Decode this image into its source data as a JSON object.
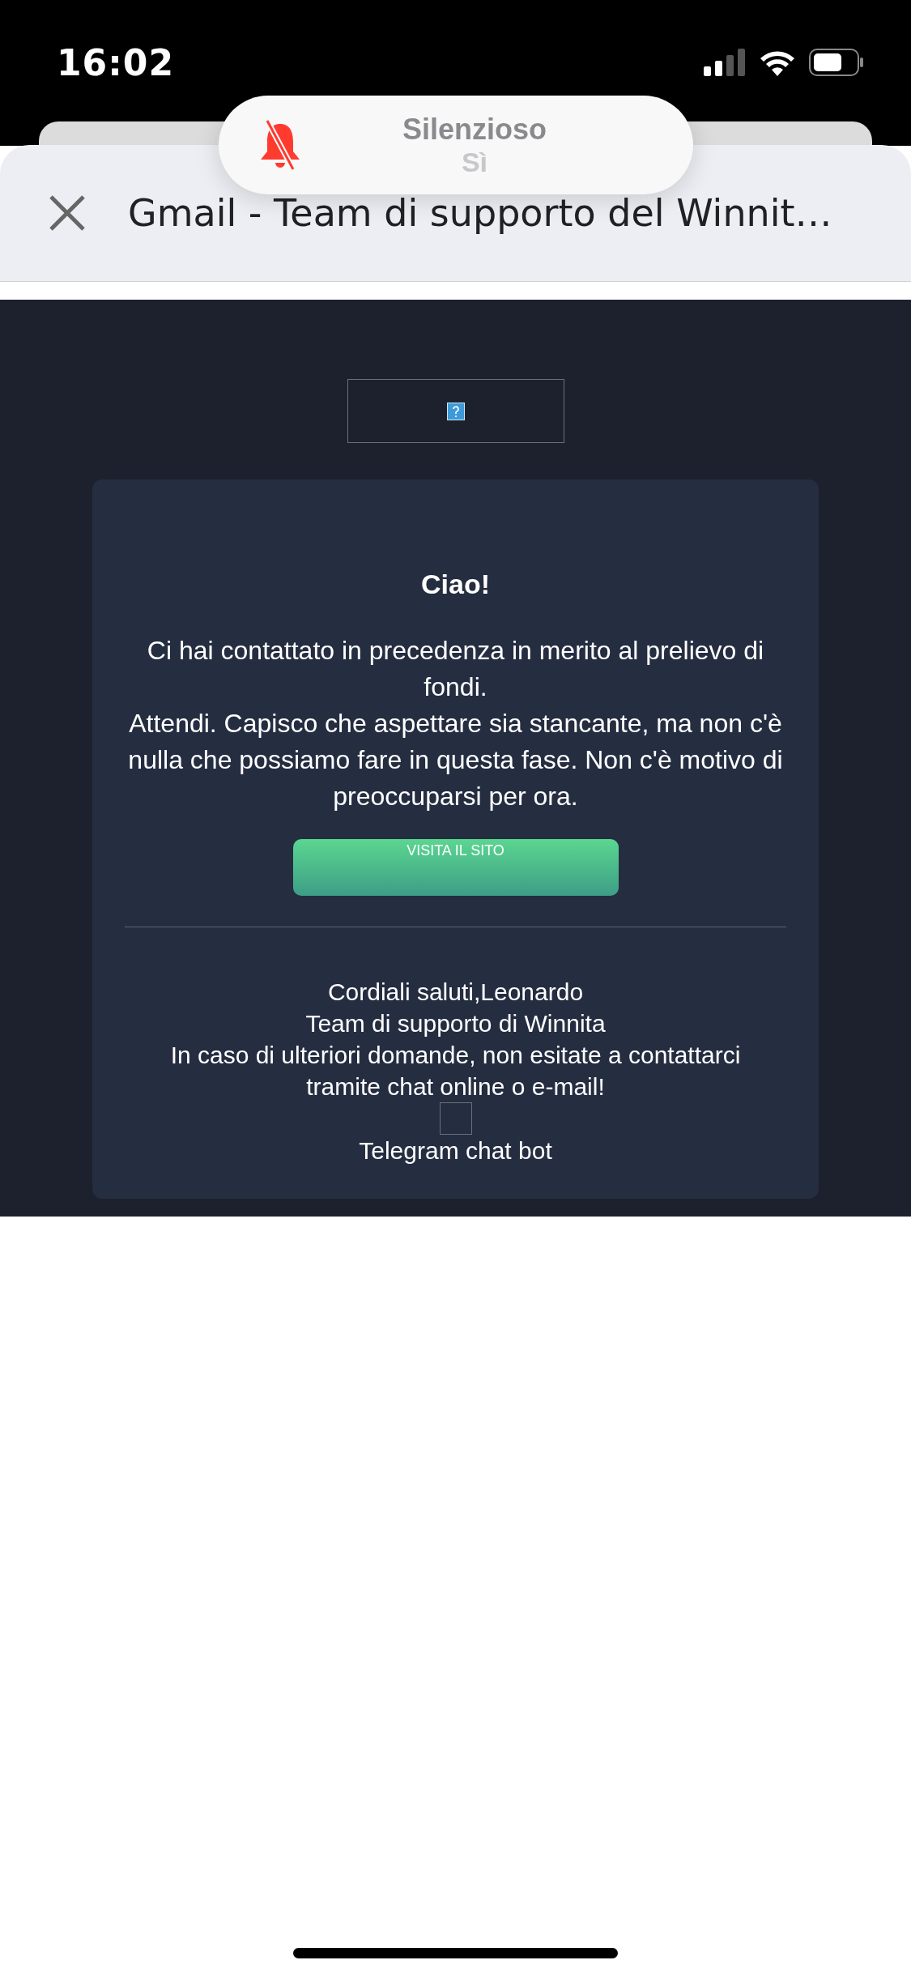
{
  "status_bar": {
    "time": "16:02"
  },
  "notification": {
    "title": "Silenzioso",
    "value": "Sì"
  },
  "browser": {
    "title": "Gmail - Team di supporto del Winnit…"
  },
  "email": {
    "greeting": "Ciao!",
    "paragraphs": [
      "Ci hai contattato in precedenza in merito al prelievo di fondi.",
      "Attendi. Capisco che aspettare sia stancante, ma non c'è nulla che possiamo fare in questa fase. Non c'è motivo di preoccuparsi per ora."
    ],
    "button": "VISITA IL SITO",
    "signature": [
      "Cordiali saluti,Leonardo",
      "Team di supporto di Winnita",
      "In caso di ulteriori domande, non esitate a contattarci tramite chat online o e-mail!"
    ],
    "telegram_link": "Telegram chat bot"
  }
}
